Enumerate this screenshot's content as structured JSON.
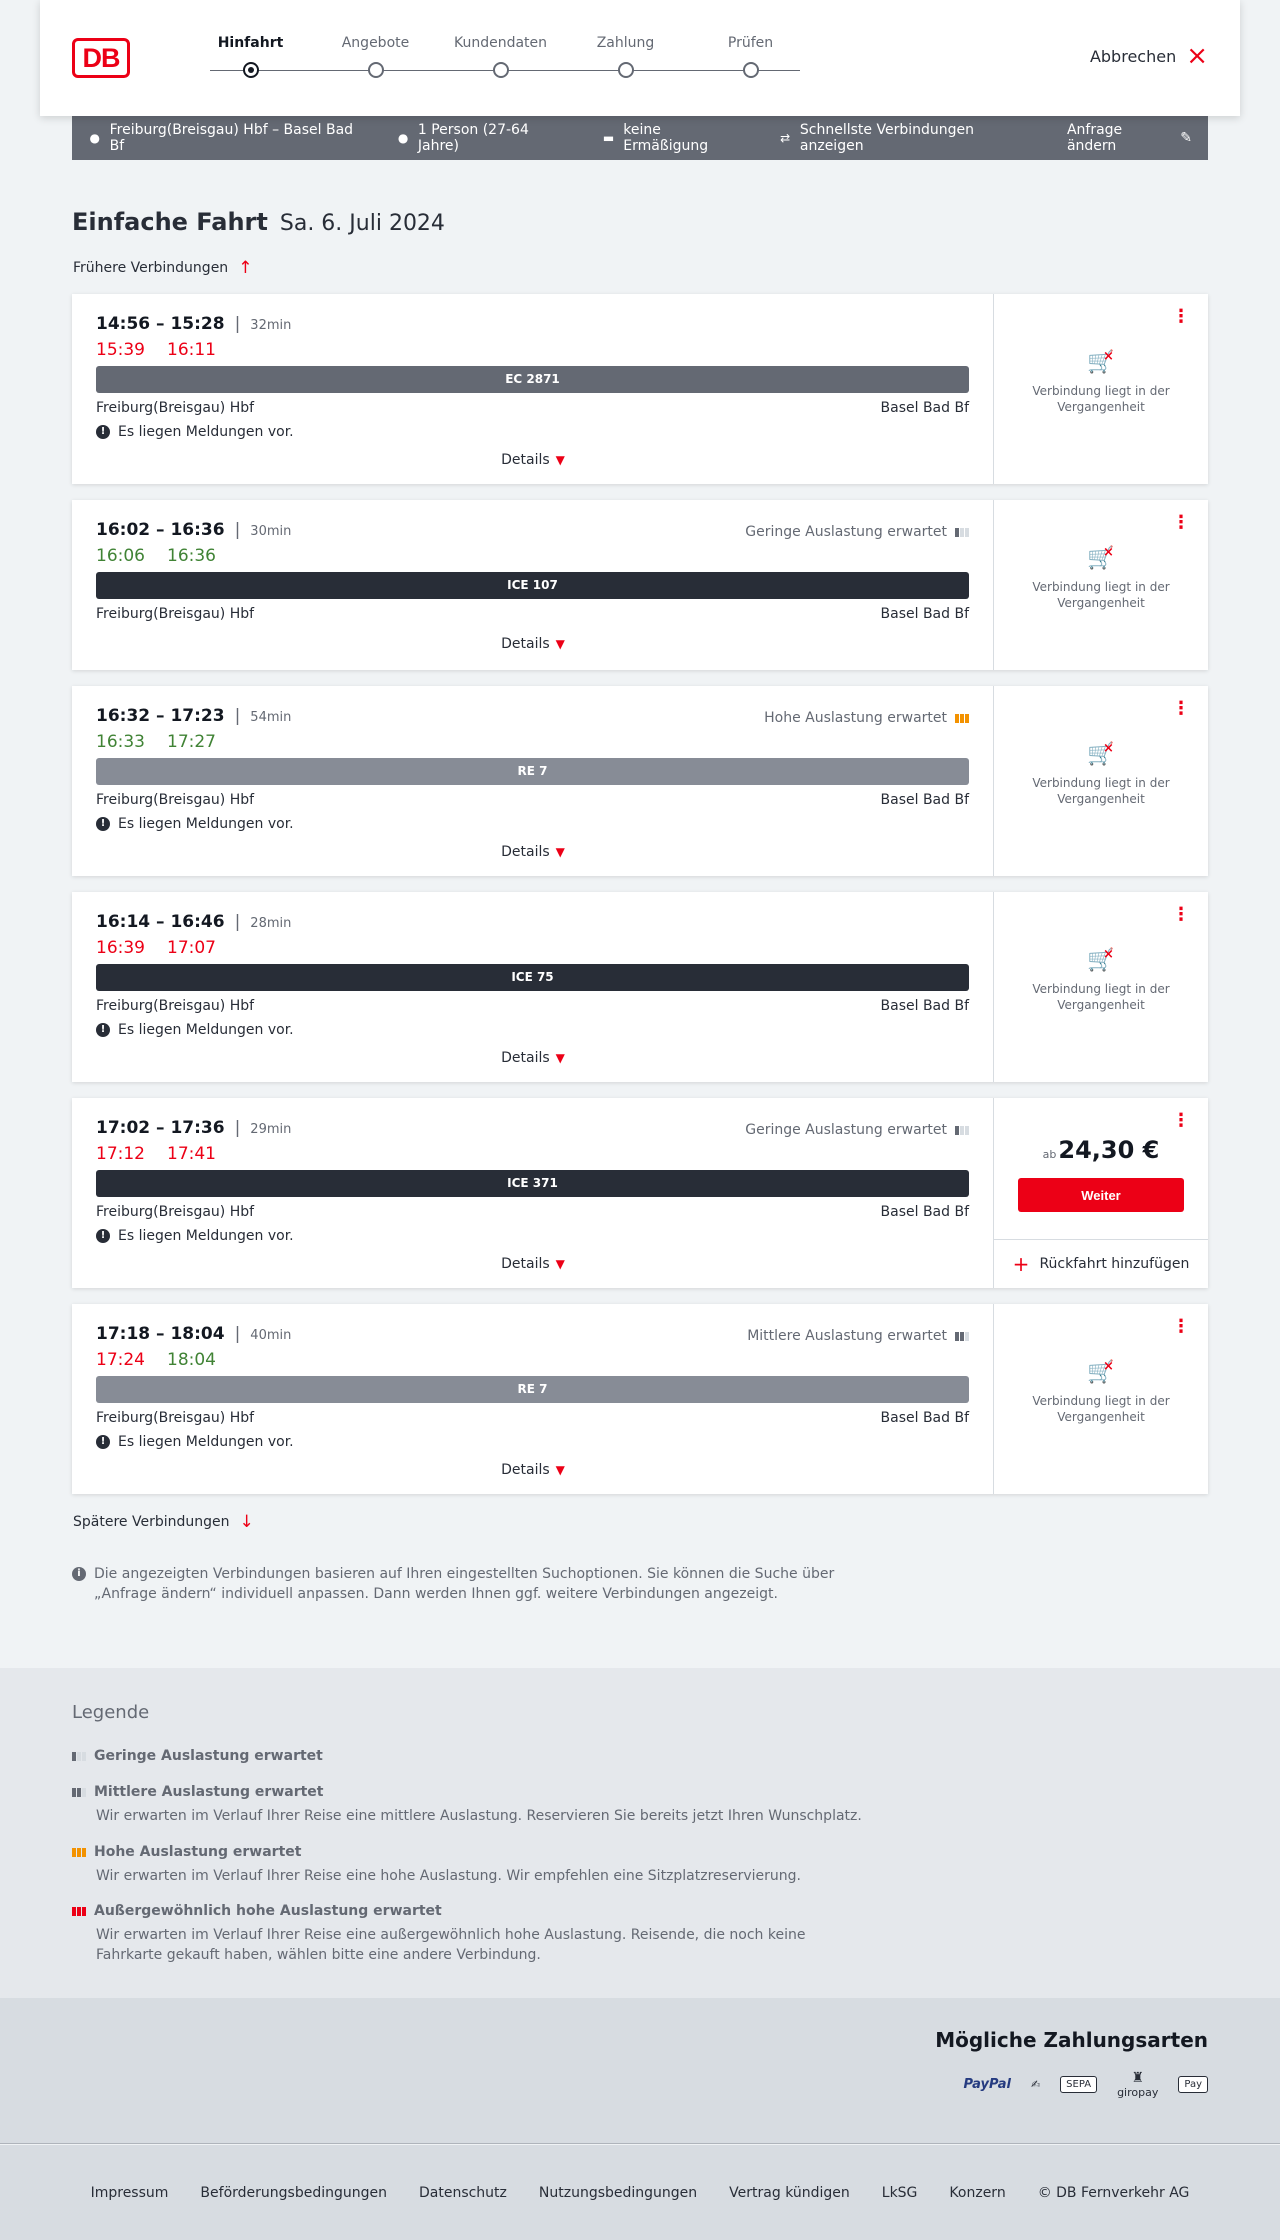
{
  "header": {
    "logo_text": "DB",
    "steps": [
      "Hinfahrt",
      "Angebote",
      "Kundendaten",
      "Zahlung",
      "Prüfen"
    ],
    "active_step": 0,
    "cancel_label": "Abbrechen"
  },
  "summary": {
    "route": "Freiburg(Breisgau) Hbf – Basel Bad Bf",
    "persons": "1 Person (27-64 Jahre)",
    "discount": "keine Ermäßigung",
    "fastest": "Schnellste Verbindungen anzeigen",
    "edit": "Anfrage ändern"
  },
  "title": {
    "trip_type": "Einfache Fahrt",
    "date": "Sa. 6. Juli 2024"
  },
  "earlier_label": "Frühere Verbindungen",
  "later_label": "Spätere Verbindungen",
  "details_label": "Details",
  "messages_label": "Es liegen Meldungen vor.",
  "past_label": "Verbindung liegt in der Vergangenheit",
  "connections": [
    {
      "times": "14:56 – 15:28",
      "duration": "32min",
      "rt_dep": "15:39",
      "rt_arr": "16:11",
      "dep_status": "late",
      "arr_status": "late",
      "occupancy": "",
      "train": "EC 2871",
      "train_color": "#646973",
      "from": "Freiburg(Breisgau) Hbf",
      "to": "Basel Bad Bf",
      "has_messages": true,
      "bookable": false
    },
    {
      "times": "16:02 – 16:36",
      "duration": "30min",
      "rt_dep": "16:06",
      "rt_arr": "16:36",
      "dep_status": "ontime",
      "arr_status": "ontime",
      "occupancy": "Geringe Auslastung erwartet",
      "occ_level": "low",
      "train": "ICE 107",
      "train_color": "#282d37",
      "from": "Freiburg(Breisgau) Hbf",
      "to": "Basel Bad Bf",
      "has_messages": false,
      "bookable": false
    },
    {
      "times": "16:32 – 17:23",
      "duration": "54min",
      "rt_dep": "16:33",
      "rt_arr": "17:27",
      "dep_status": "ontime",
      "arr_status": "ontime",
      "occupancy": "Hohe Auslastung erwartet",
      "occ_level": "high",
      "train": "RE 7",
      "train_color": "#878c96",
      "from": "Freiburg(Breisgau) Hbf",
      "to": "Basel Bad Bf",
      "has_messages": true,
      "bookable": false
    },
    {
      "times": "16:14 – 16:46",
      "duration": "28min",
      "rt_dep": "16:39",
      "rt_arr": "17:07",
      "dep_status": "late",
      "arr_status": "late",
      "occupancy": "",
      "train": "ICE 75",
      "train_color": "#282d37",
      "from": "Freiburg(Breisgau) Hbf",
      "to": "Basel Bad Bf",
      "has_messages": true,
      "bookable": false
    },
    {
      "times": "17:02 – 17:36",
      "duration": "29min",
      "rt_dep": "17:12",
      "rt_arr": "17:41",
      "dep_status": "late",
      "arr_status": "late",
      "occupancy": "Geringe Auslastung erwartet",
      "occ_level": "low",
      "train": "ICE 371",
      "train_color": "#282d37",
      "from": "Freiburg(Breisgau) Hbf",
      "to": "Basel Bad Bf",
      "has_messages": true,
      "bookable": true,
      "price_prefix": "ab",
      "price": "24,30 €",
      "continue_label": "Weiter",
      "return_label": "Rückfahrt hinzufügen"
    },
    {
      "times": "17:18 – 18:04",
      "duration": "40min",
      "rt_dep": "17:24",
      "rt_arr": "18:04",
      "dep_status": "late",
      "arr_status": "ontime",
      "occupancy": "Mittlere Auslastung erwartet",
      "occ_level": "medium",
      "train": "RE 7",
      "train_color": "#878c96",
      "from": "Freiburg(Breisgau) Hbf",
      "to": "Basel Bad Bf",
      "has_messages": true,
      "bookable": false
    }
  ],
  "info_note": "Die angezeigten Verbindungen basieren auf Ihren eingestellten Suchoptionen. Sie können die Suche über „Anfrage ändern“ individuell anpassen. Dann werden Ihnen ggf. weitere Verbindungen angezeigt.",
  "legend": {
    "title": "Legende",
    "items": [
      {
        "title": "Geringe Auslastung erwartet",
        "desc": "",
        "level": "low"
      },
      {
        "title": "Mittlere Auslastung erwartet",
        "desc": "Wir erwarten im Verlauf Ihrer Reise eine mittlere Auslastung. Reservieren Sie bereits jetzt Ihren Wunschplatz.",
        "level": "medium"
      },
      {
        "title": "Hohe Auslastung erwartet",
        "desc": "Wir erwarten im Verlauf Ihrer Reise eine hohe Auslastung. Wir empfehlen eine Sitzplatzreservierung.",
        "level": "high"
      },
      {
        "title": "Außergewöhnlich hohe Auslastung erwartet",
        "desc": "Wir erwarten im Verlauf Ihrer Reise eine außergewöhnlich hohe Auslastung. Reisende, die noch keine Fahrkarte gekauft haben, wählen bitte eine andere Verbindung.",
        "level": "extreme"
      }
    ]
  },
  "payments": {
    "title": "Mögliche Zahlungsarten",
    "methods": [
      "PayPal",
      "SEPA",
      "giropay",
      "Pay"
    ]
  },
  "footer": {
    "links": [
      "Impressum",
      "Beförderungsbedingungen",
      "Datenschutz",
      "Nutzungsbedingungen",
      "Vertrag kündigen",
      "LkSG",
      "Konzern",
      "© DB Fernverkehr AG"
    ]
  },
  "colors": {
    "brand_red": "#ec0016",
    "ontime_green": "#408335",
    "high_orange": "#f39200",
    "summary_bg": "#646973"
  }
}
